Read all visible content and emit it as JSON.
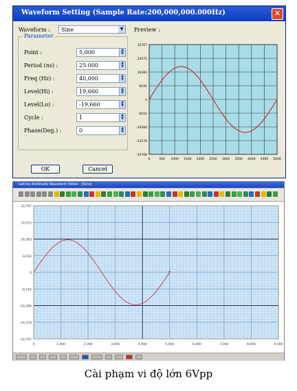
{
  "dialog": {
    "title": "Waveform Setting (Sample Rate:200,000,000.000Hz)",
    "waveform_label": "Waveform :",
    "waveform_value": "Sine",
    "parameter_label": "Parameter",
    "preview_label": "Preview :",
    "fields": [
      {
        "label": "Point :",
        "value": "5,000"
      },
      {
        "label": "Period (ns) :",
        "value": "25.000"
      },
      {
        "label": "Freq (Hz) :",
        "value": "40,000"
      },
      {
        "label": "Level(Hi) :",
        "value": "19,660"
      },
      {
        "label": "Level(Lo) :",
        "value": "-19,660"
      },
      {
        "label": "Cycle :",
        "value": "1"
      },
      {
        "label": "Phase(Deg.) :",
        "value": "0"
      }
    ],
    "ok_label": "OK",
    "cancel_label": "Cancel",
    "close_icon": "close-icon"
  },
  "software": {
    "title": "LeCroy ArbStudio Waveform Editor - [Sine]",
    "toolbar_colors": [
      "#2f7d32",
      "#3b9e3f",
      "#4caf50",
      "#2e8b57",
      "#1f6fb5",
      "#c0392b",
      "#e6b800"
    ]
  },
  "preview_chart": {
    "type": "line",
    "x_ticks": [
      "0",
      "500",
      "1000",
      "1500",
      "2000",
      "2500",
      "3000",
      "3500",
      "4000",
      "4500",
      "5000"
    ],
    "y_ticks": [
      "32767",
      "24575",
      "16383",
      "8191",
      "0",
      "-8192",
      "-16384",
      "-24576",
      "-32768"
    ],
    "xlim": [
      0,
      5000
    ],
    "ylim": [
      -32768,
      32767
    ],
    "amplitude": 19660,
    "grid": true,
    "line_color": "#cc2222",
    "bg_color": "#a8dde8"
  },
  "editor_chart": {
    "type": "line",
    "x_ticks": [
      "0",
      "1,000",
      "2,000",
      "3,000",
      "4,000",
      "5,000",
      "6,000",
      "7,000",
      "8,000",
      "9,000"
    ],
    "y_ticks": [
      "32,767",
      "24,575",
      "16,383",
      "8,192",
      "0",
      "-8,192",
      "-16,384",
      "-24,576",
      "-32,767"
    ],
    "xlim": [
      0,
      9000
    ],
    "ylim": [
      -32767,
      32767
    ],
    "period": 5000,
    "amplitude": 16000,
    "grid": true,
    "line_color": "#cc3344",
    "bg_color": "#cfe6f7"
  },
  "chart_data": [
    {
      "type": "line",
      "series": [
        {
          "x": [
            0,
            625,
            1250,
            1875,
            2500,
            3125,
            3750,
            4375,
            5000
          ],
          "values": [
            0,
            13902,
            19660,
            13902,
            0,
            -13902,
            -19660,
            -13902,
            0
          ]
        }
      ],
      "xlim": [
        0,
        5000
      ],
      "ylim": [
        -32768,
        32767
      ]
    },
    {
      "type": "line",
      "series": [
        {
          "x": [
            0,
            625,
            1250,
            1875,
            2500,
            3125,
            3750,
            4375,
            5000
          ],
          "values": [
            0,
            11314,
            16000,
            11314,
            0,
            -11314,
            -16000,
            -11314,
            0
          ]
        }
      ],
      "xlim": [
        0,
        9000
      ],
      "ylim": [
        -32767,
        32767
      ]
    }
  ],
  "caption": "Cài phạm vi độ lớn 6Vpp"
}
